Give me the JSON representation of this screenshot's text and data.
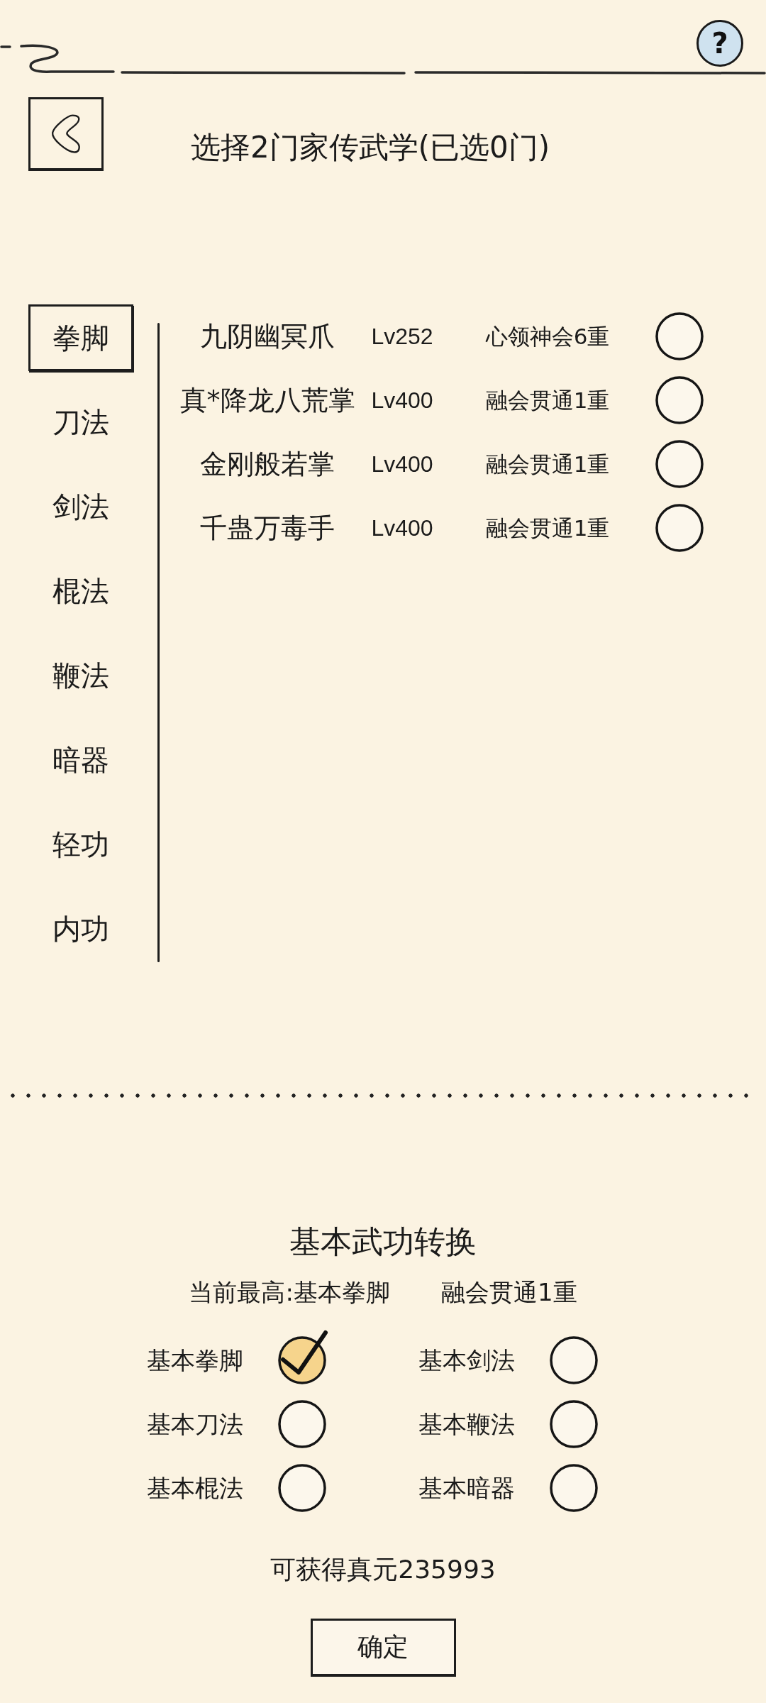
{
  "top_bar": {
    "help_button": {
      "label": "?"
    }
  },
  "header": {
    "title": "选择2门家传武学(已选0门)"
  },
  "categories": [
    {
      "label": "拳脚",
      "selected": true
    },
    {
      "label": "刀法",
      "selected": false
    },
    {
      "label": "剑法",
      "selected": false
    },
    {
      "label": "棍法",
      "selected": false
    },
    {
      "label": "鞭法",
      "selected": false
    },
    {
      "label": "暗器",
      "selected": false
    },
    {
      "label": "轻功",
      "selected": false
    },
    {
      "label": "内功",
      "selected": false
    }
  ],
  "skills": [
    {
      "name": "九阴幽冥爪",
      "lv": "Lv252",
      "realm": "心领神会6重",
      "selected": false
    },
    {
      "name": "真*降龙八荒掌",
      "lv": "Lv400",
      "realm": "融会贯通1重",
      "selected": false
    },
    {
      "name": "金刚般若掌",
      "lv": "Lv400",
      "realm": "融会贯通1重",
      "selected": false
    },
    {
      "name": "千蛊万毒手",
      "lv": "Lv400",
      "realm": "融会贯通1重",
      "selected": false
    }
  ],
  "conversion": {
    "title": "基本武功转换",
    "current_best": "当前最高:基本拳脚",
    "current_realm": "融会贯通1重",
    "options": [
      {
        "label": "基本拳脚",
        "selected": true
      },
      {
        "label": "基本剑法",
        "selected": false
      },
      {
        "label": "基本刀法",
        "selected": false
      },
      {
        "label": "基本鞭法",
        "selected": false
      },
      {
        "label": "基本棍法",
        "selected": false
      },
      {
        "label": "基本暗器",
        "selected": false
      }
    ]
  },
  "reward": "可获得真元235993",
  "confirm_button": {
    "label": "确定"
  }
}
